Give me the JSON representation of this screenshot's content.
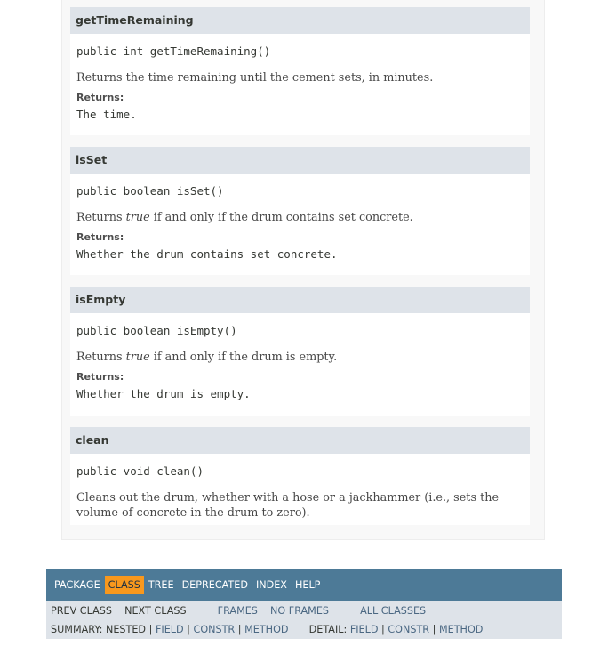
{
  "methods": [
    {
      "name": "getTimeRemaining",
      "signature": "public int getTimeRemaining()",
      "description_pre": "Returns the time remaining until the cement sets, in minutes.",
      "description_italic": "",
      "description_post": "",
      "returns_label": "Returns:",
      "returns_value": "The time."
    },
    {
      "name": "isSet",
      "signature": "public boolean isSet()",
      "description_pre": "Returns ",
      "description_italic": "true",
      "description_post": " if and only if the drum contains set concrete.",
      "returns_label": "Returns:",
      "returns_value": "Whether the drum contains set concrete."
    },
    {
      "name": "isEmpty",
      "signature": "public boolean isEmpty()",
      "description_pre": "Returns ",
      "description_italic": "true",
      "description_post": " if and only if the drum is empty.",
      "returns_label": "Returns:",
      "returns_value": "Whether the drum is empty."
    },
    {
      "name": "clean",
      "signature": "public void clean()",
      "description_pre": "Cleans out the drum, whether with a hose or a jackhammer (i.e., sets the volume of concrete in the drum to zero).",
      "description_italic": "",
      "description_post": ""
    }
  ],
  "nav": {
    "items": [
      "PACKAGE",
      "CLASS",
      "TREE",
      "DEPRECATED",
      "INDEX",
      "HELP"
    ],
    "active": "CLASS",
    "prev_class": "PREV CLASS",
    "next_class": "NEXT CLASS",
    "frames": "FRAMES",
    "no_frames": "NO FRAMES",
    "all_classes": "ALL CLASSES",
    "summary_label": "SUMMARY:",
    "summary_nested": "NESTED",
    "summary_links": [
      "FIELD",
      "CONSTR",
      "METHOD"
    ],
    "detail_label": "DETAIL:",
    "detail_links": [
      "FIELD",
      "CONSTR",
      "METHOD"
    ],
    "separator": "|"
  },
  "colors": {
    "nav_bg": "#4d7a97",
    "nav_active": "#f8981d",
    "header_bg": "#dee3e9",
    "link": "#4a6782"
  }
}
